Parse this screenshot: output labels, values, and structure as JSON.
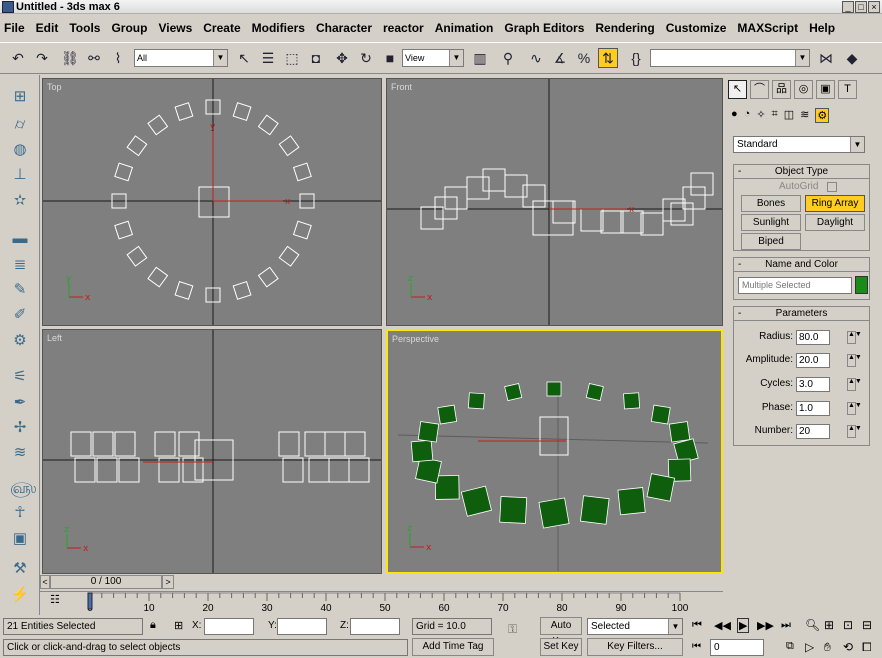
{
  "window": {
    "title": "Untitled - 3ds max 6"
  },
  "menu": [
    "File",
    "Edit",
    "Tools",
    "Group",
    "Views",
    "Create",
    "Modifiers",
    "Character",
    "reactor",
    "Animation",
    "Graph Editors",
    "Rendering",
    "Customize",
    "MAXScript",
    "Help"
  ],
  "toolbar": {
    "filter_value": "All",
    "coord_value": "View",
    "named_sel_value": ""
  },
  "viewports": {
    "top": "Top",
    "front": "Front",
    "left": "Left",
    "perspective": "Perspective"
  },
  "axes": {
    "x": "x",
    "y": "y",
    "z": "z"
  },
  "command_panel": {
    "category": "Standard",
    "object_type_title": "Object Type",
    "autogrid_label": "AutoGrid",
    "buttons": [
      "Bones",
      "Ring Array",
      "Sunlight",
      "Daylight",
      "Biped"
    ],
    "active_button": "Ring Array",
    "name_color_title": "Name and Color",
    "name_value": "Multiple Selected",
    "object_color": "#1a8a1a",
    "parameters_title": "Parameters",
    "params": [
      {
        "label": "Radius:",
        "value": "80.0"
      },
      {
        "label": "Amplitude:",
        "value": "20.0"
      },
      {
        "label": "Cycles:",
        "value": "3.0"
      },
      {
        "label": "Phase:",
        "value": "1.0"
      },
      {
        "label": "Number:",
        "value": "20"
      }
    ]
  },
  "time": {
    "slider_label": "0 / 100",
    "ticks": [
      "0",
      "10",
      "20",
      "30",
      "40",
      "50",
      "60",
      "70",
      "80",
      "90",
      "100"
    ]
  },
  "status": {
    "selection": "21 Entities Selected",
    "prompt": "Click or click-and-drag to select objects",
    "x_label": "X:",
    "y_label": "Y:",
    "z_label": "Z:",
    "grid": "Grid = 10.0",
    "add_time_tag": "Add Time Tag",
    "auto_key": "Auto Key",
    "set_key": "Set Key",
    "key_mode": "Selected",
    "key_filters": "Key Filters...",
    "frame": "0"
  },
  "colors": {
    "viewport_bg": "#7f7f7f",
    "active_border": "#ffe600",
    "active_button": "#ffcc22",
    "box_green": "#0e5e0e"
  }
}
